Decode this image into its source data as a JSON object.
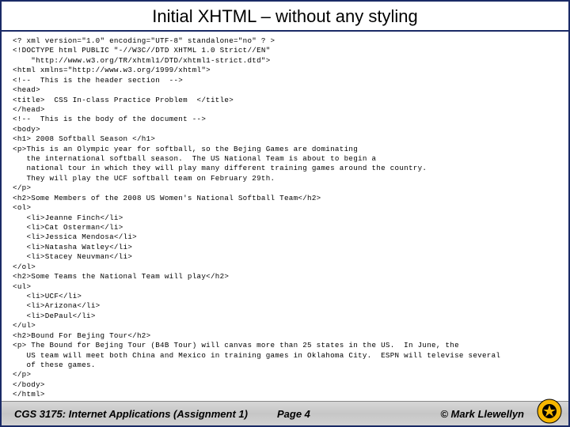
{
  "title": "Initial XHTML – without any styling",
  "code": "<? xml version=\"1.0\" encoding=\"UTF-8\" standalone=\"no\" ? >\n<!DOCTYPE html PUBLIC \"-//W3C//DTD XHTML 1.0 Strict//EN\"\n    \"http://www.w3.org/TR/xhtml1/DTD/xhtml1-strict.dtd\">\n<html xmlns=\"http://www.w3.org/1999/xhtml\">\n<!--  This is the header section  -->\n<head>\n<title>  CSS In-class Practice Problem  </title>\n</head>\n<!--  This is the body of the document -->\n<body>\n<h1> 2008 Softball Season </h1>\n<p>This is an Olympic year for softball, so the Bejing Games are dominating\n   the international softball season.  The US National Team is about to begin a\n   national tour in which they will play many different training games around the country.\n   They will play the UCF softball team on February 29th.\n</p>\n<h2>Some Members of the 2008 US Women's National Softball Team</h2>\n<ol>\n   <li>Jeanne Finch</li>\n   <li>Cat Osterman</li>\n   <li>Jessica Mendosa</li>\n   <li>Natasha Watley</li>\n   <li>Stacey Neuvman</li>\n</ol>\n<h2>Some Teams the National Team will play</h2>\n<ul>\n   <li>UCF</li>\n   <li>Arizona</li>\n   <li>DePaul</li>\n</ul>\n<h2>Bound For Bejing Tour</h2>\n<p> The Bound for Bejing Tour (B4B Tour) will canvas more than 25 states in the US.  In June, the\n   US team will meet both China and Mexico in training games in Oklahoma City.  ESPN will televise several\n   of these games.\n</p>\n</body>\n</html>",
  "footer": {
    "left": "CGS 3175: Internet Applications (Assignment 1)",
    "center": "Page 4",
    "right": "© Mark Llewellyn"
  }
}
